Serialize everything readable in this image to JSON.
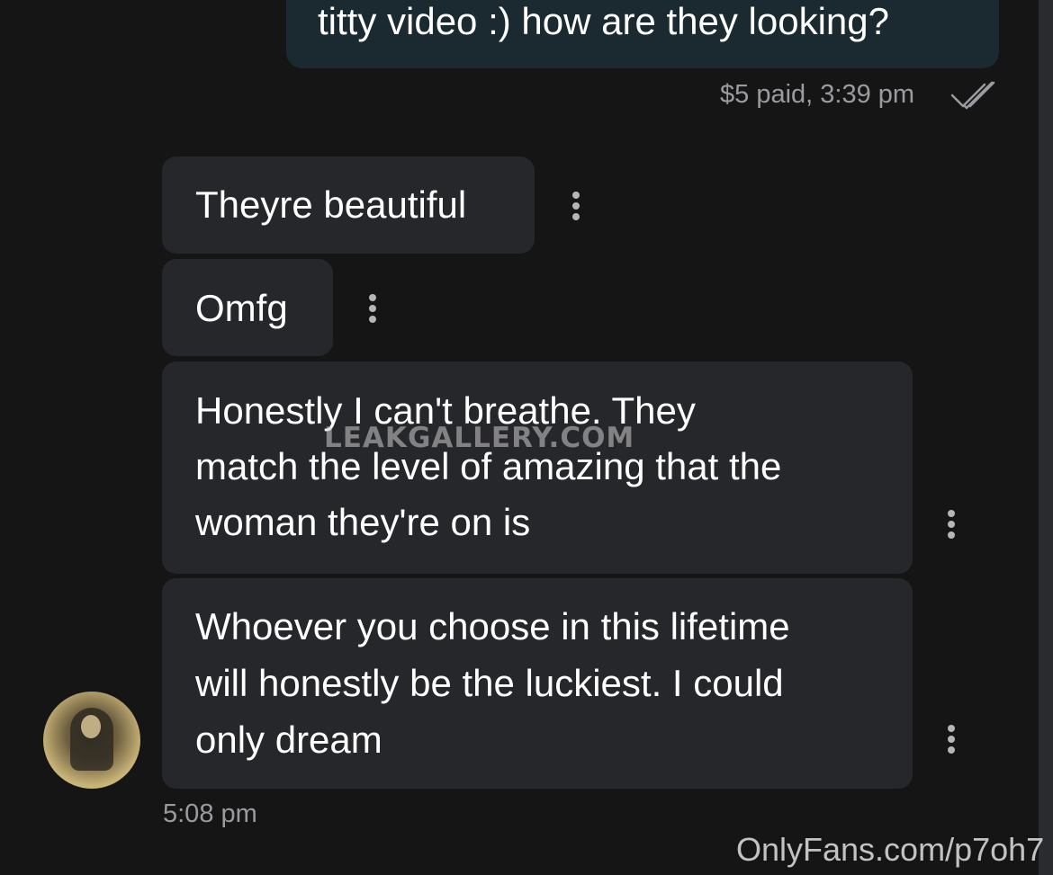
{
  "sent_message": {
    "text": "titty video :) how are they looking?",
    "meta": "$5 paid,  3:39 pm",
    "status_icon": "double-check-icon"
  },
  "received_messages": [
    {
      "text": "Theyre beautiful",
      "options_icon": "more-vertical-icon"
    },
    {
      "text": "Omfg",
      "options_icon": "more-vertical-icon"
    },
    {
      "lines": [
        "Honestly I can't breathe. They",
        "match the level of amazing that the",
        "woman they're on is"
      ],
      "options_icon": "more-vertical-icon"
    },
    {
      "lines": [
        "Whoever you choose in this lifetime",
        "will honestly be the luckiest. I could",
        "only dream"
      ],
      "options_icon": "more-vertical-icon"
    }
  ],
  "received_time": "5:08 pm",
  "watermarks": {
    "overlay": "LEAKGALLERY.COM",
    "corner": "OnlyFans.com/p7oh7"
  },
  "colors": {
    "background": "#151516",
    "received_bubble": "#26272b",
    "sent_bubble": "#1b2a30",
    "meta_text": "#9a9b9e"
  }
}
